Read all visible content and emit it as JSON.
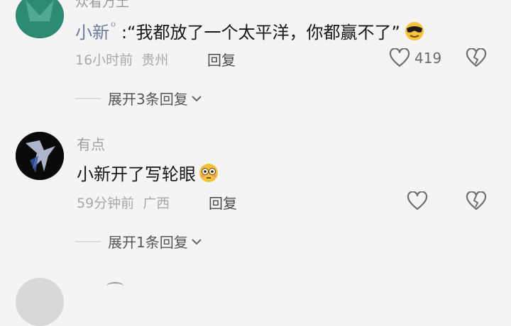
{
  "comment1": {
    "parent_author": "众看万土",
    "author": "小新",
    "author_marker": "ᴼ",
    "text": ":“我都放了一个太平洋，你都赢不了”",
    "time": "16小时前",
    "location": "贵州",
    "reply_label": "回复",
    "like_count": "419",
    "expand_label": "展开3条回复"
  },
  "comment2": {
    "author": "有点",
    "text": "小新开了写轮眼",
    "time": "59分钟前",
    "location": "广西",
    "reply_label": "回复",
    "expand_label": "展开1条回复"
  },
  "colors": {
    "background": "#f4f4f4",
    "author_name": "#6a7c9a",
    "meta_gray": "#a9a9a9"
  }
}
